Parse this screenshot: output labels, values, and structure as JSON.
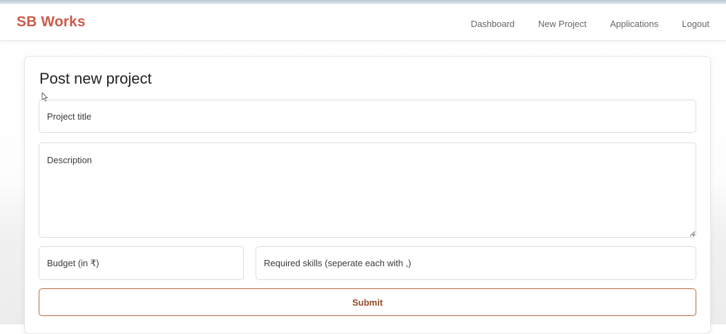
{
  "navbar": {
    "brand": "SB Works",
    "links": [
      "Dashboard",
      "New Project",
      "Applications",
      "Logout"
    ]
  },
  "form": {
    "title": "Post new project",
    "project_title_placeholder": "Project title",
    "description_placeholder": "Description",
    "budget_placeholder": "Budget (in ₹)",
    "skills_placeholder": "Required skills (seperate each with ,)",
    "submit_label": "Submit"
  },
  "colors": {
    "brand": "#cc5b4a",
    "submit_border": "#b5673c",
    "submit_text": "#8f4a24"
  },
  "icons": {
    "cursor": "mouse-cursor-icon",
    "resize": "resize-handle-icon"
  }
}
